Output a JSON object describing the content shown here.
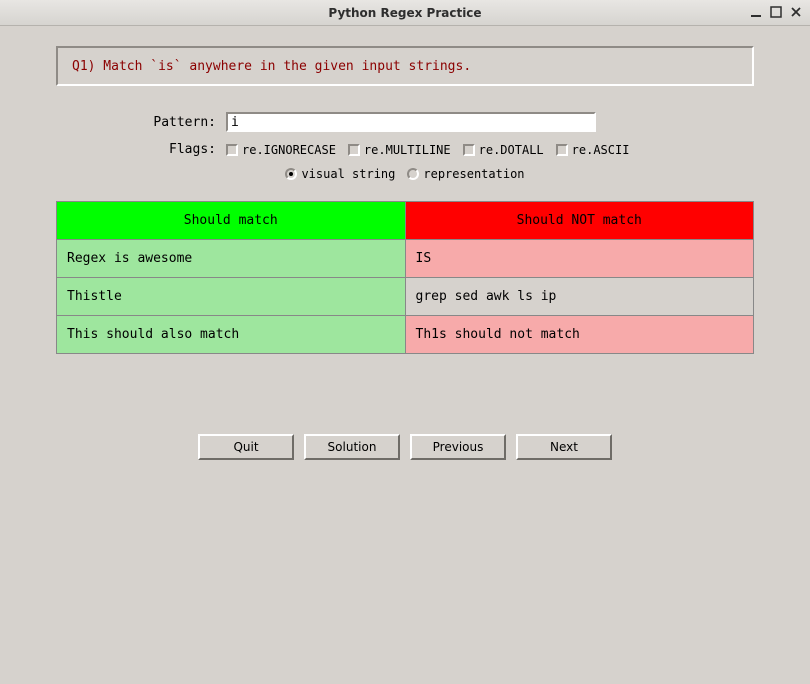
{
  "window": {
    "title": "Python Regex Practice"
  },
  "question": {
    "text": "Q1) Match `is` anywhere in the given input strings."
  },
  "form": {
    "pattern_label": "Pattern:",
    "pattern_value": "i",
    "flags_label": "Flags:",
    "flags": [
      {
        "label": "re.IGNORECASE"
      },
      {
        "label": "re.MULTILINE"
      },
      {
        "label": "re.DOTALL"
      },
      {
        "label": "re.ASCII"
      }
    ],
    "view_modes": {
      "visual": "visual string",
      "repr": "representation"
    }
  },
  "table": {
    "header_match": "Should match",
    "header_nomatch": "Should NOT match",
    "rows": [
      {
        "match": "Regex is awesome",
        "nomatch": "IS",
        "nomatch_class": "cell-pink"
      },
      {
        "match": "Thistle",
        "nomatch": "grep sed awk ls ip",
        "nomatch_class": "cell-gray"
      },
      {
        "match": "This should also match",
        "nomatch": "Th1s should not match",
        "nomatch_class": "cell-pink"
      }
    ]
  },
  "buttons": {
    "quit": "Quit",
    "solution": "Solution",
    "previous": "Previous",
    "next": "Next"
  }
}
